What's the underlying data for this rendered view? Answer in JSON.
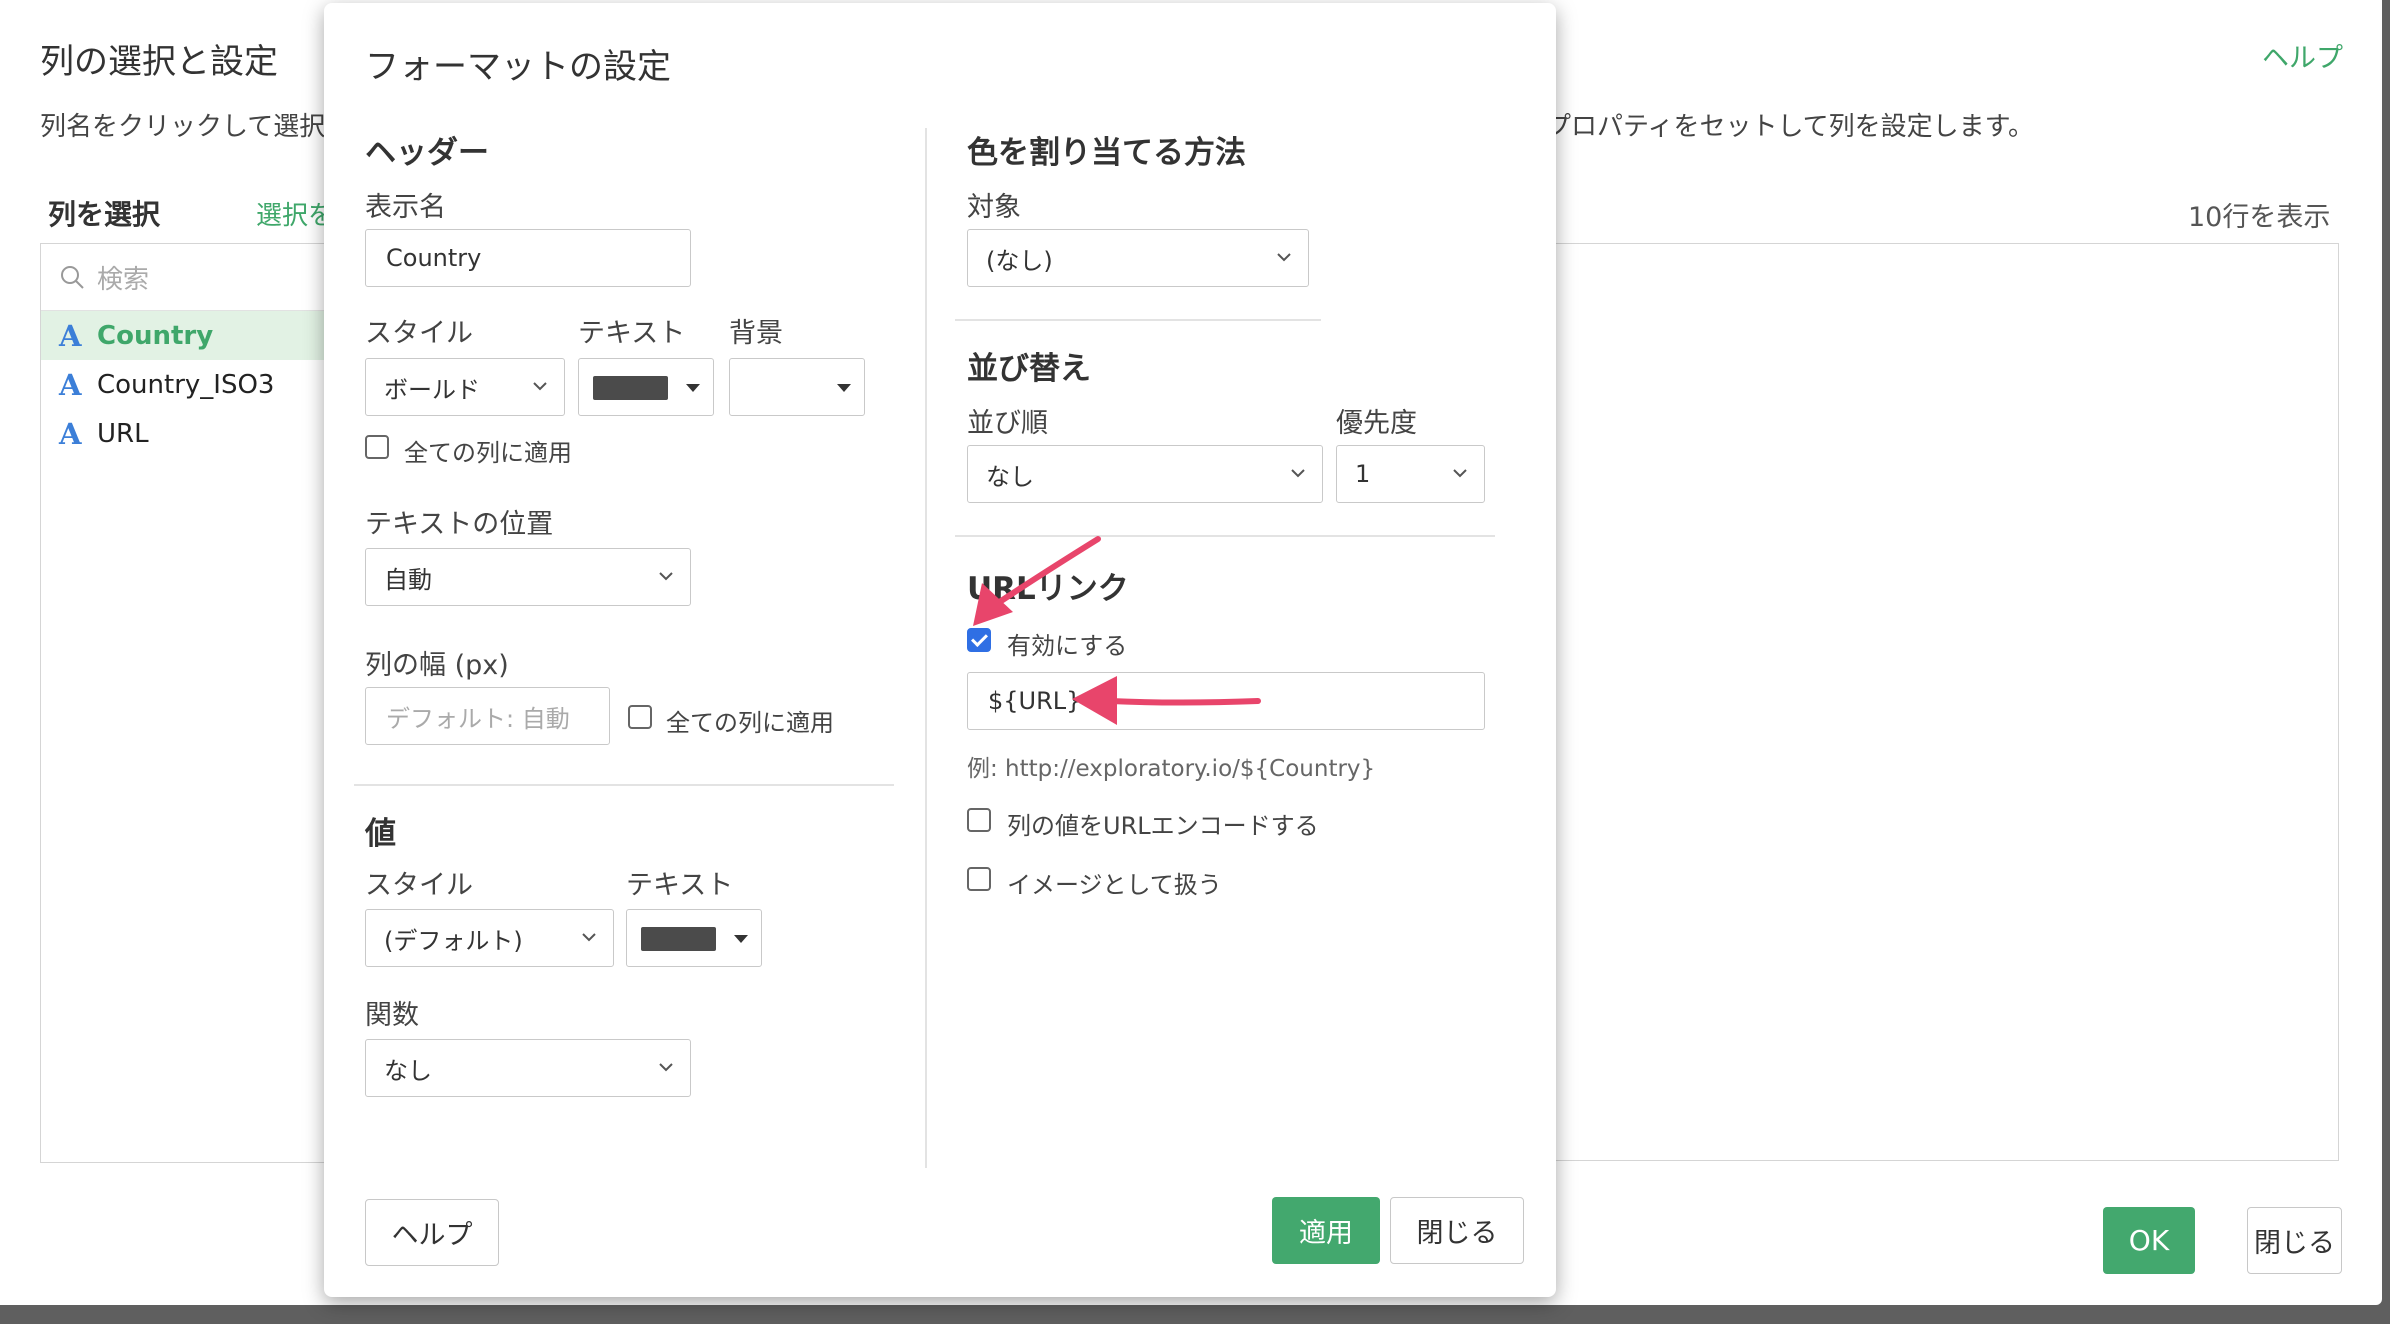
{
  "background": {
    "title": "列の選択と設定",
    "help": "ヘルプ",
    "description_left": "列名をクリックして選択",
    "description_right": "プロパティをセットして列を設定します。",
    "column_select_label": "列を選択",
    "select_all_link": "選択を",
    "rows_label": "10行を表示",
    "search_placeholder": "検索",
    "columns": [
      {
        "type_icon": "A",
        "name": "Country"
      },
      {
        "type_icon": "A",
        "name": "Country_ISO3"
      },
      {
        "type_icon": "A",
        "name": "URL"
      }
    ],
    "ok_button": "OK",
    "close_button": "閉じる"
  },
  "modal": {
    "title": "フォーマットの設定",
    "header": {
      "section_title": "ヘッダー",
      "display_name_label": "表示名",
      "display_name_value": "Country",
      "style_label": "スタイル",
      "text_label": "テキスト",
      "background_label": "背景",
      "style_value": "ボールド",
      "apply_all_label": "全ての列に適用",
      "text_position_label": "テキストの位置",
      "text_position_value": "自動",
      "column_width_label": "列の幅 (px)",
      "column_width_placeholder": "デフォルト: 自動",
      "width_apply_all_label": "全ての列に適用"
    },
    "value": {
      "section_title": "値",
      "style_label": "スタイル",
      "text_label": "テキスト",
      "style_value": "(デフォルト)",
      "function_label": "関数",
      "function_value": "なし"
    },
    "color": {
      "section_title": "色を割り当てる方法",
      "target_label": "対象",
      "target_value": "(なし)"
    },
    "sort": {
      "section_title": "並び替え",
      "order_label": "並び順",
      "priority_label": "優先度",
      "order_value": "なし",
      "priority_value": "1"
    },
    "url_link": {
      "section_title": "URLリンク",
      "enable_label": "有効にする",
      "url_value": "${URL}",
      "example": "例: http://exploratory.io/${Country}",
      "encode_label": "列の値をURLエンコードする",
      "image_label": "イメージとして扱う"
    },
    "help_button": "ヘルプ",
    "apply_button": "適用",
    "close_button": "閉じる"
  },
  "colors": {
    "accent_green": "#43a86e",
    "arrow_pink": "#e8456b",
    "checkbox_blue": "#2f6fe4"
  }
}
